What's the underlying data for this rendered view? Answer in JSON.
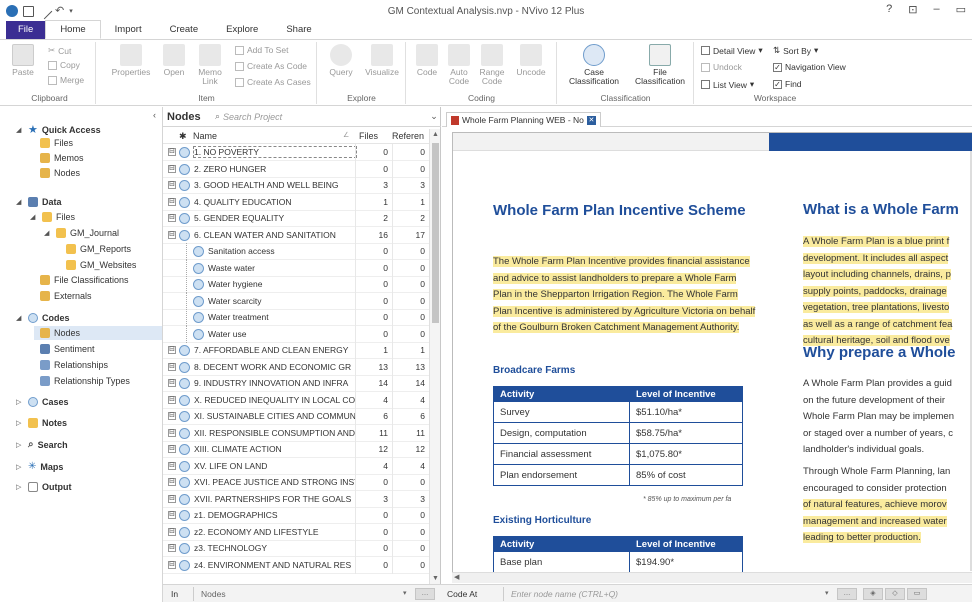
{
  "titlebar": {
    "title": "GM Contextual Analysis.nvp - NVivo 12 Plus",
    "controls": [
      "?",
      "⊡",
      "–",
      "▭"
    ]
  },
  "ribbon_tabs": [
    "File",
    "Home",
    "Import",
    "Create",
    "Explore",
    "Share"
  ],
  "ribbon": {
    "clipboard": {
      "label": "Clipboard",
      "paste": "Paste",
      "cut": "Cut",
      "copy": "Copy",
      "merge": "Merge"
    },
    "item": {
      "label": "Item",
      "properties": "Properties",
      "open": "Open",
      "memo_link": "Memo Link",
      "add_to_set": "Add To Set",
      "create_as_code": "Create As Code",
      "create_as_cases": "Create As Cases"
    },
    "explore": {
      "label": "Explore",
      "query": "Query",
      "visualize": "Visualize"
    },
    "coding": {
      "label": "Coding",
      "code": "Code",
      "auto_code": "Auto Code",
      "range_code": "Range Code",
      "uncode": "Uncode"
    },
    "classification": {
      "label": "Classification",
      "case_classification": "Case Classification",
      "file_classification": "File Classification"
    },
    "workspace": {
      "label": "Workspace",
      "detail_view": "Detail View",
      "sort_by": "Sort By",
      "undock": "Undock",
      "navigation_view": "Navigation View",
      "list_view": "List View",
      "find": "Find"
    }
  },
  "nav": {
    "quick_access": "Quick Access",
    "files": "Files",
    "memos": "Memos",
    "nodes": "Nodes",
    "data": "Data",
    "data_files": "Files",
    "gm_journal": "GM_Journal",
    "gm_reports": "GM_Reports",
    "gm_websites": "GM_Websites",
    "file_classifications": "File Classifications",
    "externals": "Externals",
    "codes": "Codes",
    "codes_nodes": "Nodes",
    "sentiment": "Sentiment",
    "relationships": "Relationships",
    "relationship_types": "Relationship Types",
    "cases": "Cases",
    "notes": "Notes",
    "search": "Search",
    "maps": "Maps",
    "output": "Output"
  },
  "nodes_panel": {
    "title": "Nodes",
    "search_placeholder": "Search Project",
    "col_name": "Name",
    "col_files": "Files",
    "col_refs": "Referen",
    "rows": [
      {
        "name": "1. NO POVERTY",
        "files": "0",
        "refs": "0",
        "exp": "⊟",
        "child": false
      },
      {
        "name": "2. ZERO HUNGER",
        "files": "0",
        "refs": "0",
        "exp": "⊟",
        "child": false
      },
      {
        "name": "3. GOOD HEALTH AND WELL BEING",
        "files": "3",
        "refs": "3",
        "exp": "⊟",
        "child": false
      },
      {
        "name": "4. QUALITY EDUCATION",
        "files": "1",
        "refs": "1",
        "exp": "⊟",
        "child": false
      },
      {
        "name": "5. GENDER EQUALITY",
        "files": "2",
        "refs": "2",
        "exp": "⊟",
        "child": false
      },
      {
        "name": "6. CLEAN WATER AND SANITATION",
        "files": "16",
        "refs": "17",
        "exp": "⊟",
        "child": false
      },
      {
        "name": "Sanitation access",
        "files": "0",
        "refs": "0",
        "exp": "",
        "child": true
      },
      {
        "name": "Waste water",
        "files": "0",
        "refs": "0",
        "exp": "",
        "child": true
      },
      {
        "name": "Water hygiene",
        "files": "0",
        "refs": "0",
        "exp": "",
        "child": true
      },
      {
        "name": "Water scarcity",
        "files": "0",
        "refs": "0",
        "exp": "",
        "child": true
      },
      {
        "name": "Water treatment",
        "files": "0",
        "refs": "0",
        "exp": "",
        "child": true
      },
      {
        "name": "Water use",
        "files": "0",
        "refs": "0",
        "exp": "",
        "child": true
      },
      {
        "name": "7. AFFORDABLE AND CLEAN ENERGY",
        "files": "1",
        "refs": "1",
        "exp": "⊟",
        "child": false
      },
      {
        "name": "8. DECENT WORK AND ECONOMIC GR",
        "files": "13",
        "refs": "13",
        "exp": "⊟",
        "child": false
      },
      {
        "name": "9. INDUSTRY INNOVATION AND INFRA",
        "files": "14",
        "refs": "14",
        "exp": "⊟",
        "child": false
      },
      {
        "name": "X. REDUCED INEQUALITY IN LOCAL CO",
        "files": "4",
        "refs": "4",
        "exp": "⊟",
        "child": false
      },
      {
        "name": "XI. SUSTAINABLE CITIES AND COMMUN",
        "files": "6",
        "refs": "6",
        "exp": "⊟",
        "child": false
      },
      {
        "name": "XII. RESPONSIBLE CONSUMPTION AND",
        "files": "11",
        "refs": "11",
        "exp": "⊟",
        "child": false
      },
      {
        "name": "XIII. CLIMATE ACTION",
        "files": "12",
        "refs": "12",
        "exp": "⊟",
        "child": false
      },
      {
        "name": "XV. LIFE ON LAND",
        "files": "4",
        "refs": "4",
        "exp": "⊟",
        "child": false
      },
      {
        "name": "XVI. PEACE JUSTICE AND STRONG INSTI",
        "files": "0",
        "refs": "0",
        "exp": "⊟",
        "child": false
      },
      {
        "name": "XVII. PARTNERSHIPS FOR THE GOALS",
        "files": "3",
        "refs": "3",
        "exp": "⊟",
        "child": false
      },
      {
        "name": "z1. DEMOGRAPHICS",
        "files": "0",
        "refs": "0",
        "exp": "⊟",
        "child": false
      },
      {
        "name": "z2. ECONOMY AND LIFESTYLE",
        "files": "0",
        "refs": "0",
        "exp": "⊟",
        "child": false
      },
      {
        "name": "z3. TECHNOLOGY",
        "files": "0",
        "refs": "0",
        "exp": "⊟",
        "child": false
      },
      {
        "name": "z4. ENVIRONMENT AND NATURAL RES",
        "files": "0",
        "refs": "0",
        "exp": "⊟",
        "child": false
      }
    ]
  },
  "doc": {
    "tab_label": "Whole Farm Planning WEB - No",
    "left_heading": "Whole Farm Plan Incentive Scheme",
    "left_para": "The Whole Farm Plan Incentive provides financial assistance and advice to assist landholders to prepare a Whole Farm Plan in the Shepparton Irrigation Region. The Whole Farm Plan Incentive is administered by Agriculture Victoria on behalf of the Goulburn Broken Catchment Management Authority.",
    "broadacre_heading": "Broadcare Farms",
    "table1": {
      "headers": [
        "Activity",
        "Level of Incentive"
      ],
      "rows": [
        [
          "Survey",
          "$51.10/ha*"
        ],
        [
          "Design, computation",
          "$58.75/ha*"
        ],
        [
          "Financial assessment",
          "$1,075.80*"
        ],
        [
          "Plan endorsement",
          "85% of cost"
        ]
      ]
    },
    "footnote": "* 85% up to maximum per fa",
    "horticulture_heading": "Existing Horticulture",
    "table2": {
      "headers": [
        "Activity",
        "Level of Incentive"
      ],
      "rows": [
        [
          "Base plan",
          "$194.90*"
        ]
      ]
    },
    "right_heading1": "What is a Whole Farm",
    "right_para1": [
      "A Whole Farm Plan is a blue print f",
      "development. It includes all aspect",
      "layout including channels, drains, p",
      "supply points, paddocks, drainage",
      "vegetation, tree plantations, livesto",
      "as well as a range of catchment fea",
      "cultural heritage, soil and flood ove"
    ],
    "right_heading2": "Why prepare a Whole",
    "right_para2": [
      "A Whole Farm Plan provides a guid",
      "on the future development of their",
      "Whole Farm Plan may be implemen",
      "or staged over a number of years, c",
      "landholder's individual goals."
    ],
    "right_para3": [
      "Through Whole Farm Planning, lan",
      "encouraged to consider protection",
      "of natural features, achieve morov",
      "management and increased water",
      "leading to better production."
    ]
  },
  "statusbar": {
    "in_label": "In",
    "in_value": "Nodes",
    "code_at_label": "Code At",
    "code_at_placeholder": "Enter node name (CTRL+Q)"
  }
}
